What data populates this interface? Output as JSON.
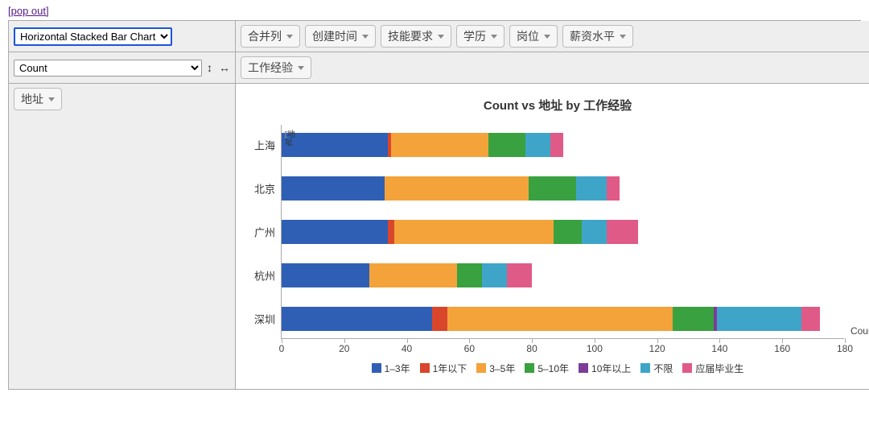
{
  "pop_out_label": "[pop out]",
  "chart_type_selector": {
    "value": "Horizontal Stacked Bar Chart"
  },
  "aggregator_selector": {
    "value": "Count"
  },
  "sort_icons": {
    "vert": "↕",
    "horiz": "↔"
  },
  "top_filters": [
    "合并列",
    "创建时间",
    "技能要求",
    "学历",
    "岗位",
    "薪资水平"
  ],
  "col_field_pill": "工作经验",
  "row_field_pill": "地址",
  "chart_data": {
    "type": "bar",
    "orientation": "horizontal",
    "stacked": true,
    "title": "Count vs 地址 by 工作经验",
    "xlabel": "Count",
    "ylabel": "",
    "xlim": [
      0,
      180
    ],
    "categories": [
      "上海",
      "北京",
      "广州",
      "深圳",
      "杭州"
    ],
    "display_order": [
      "上海",
      "北京",
      "广州",
      "杭州",
      "深圳"
    ],
    "series": [
      {
        "name": "1–3年",
        "color": "#2f5fb5",
        "values": [
          34,
          33,
          34,
          48,
          28
        ]
      },
      {
        "name": "1年以下",
        "color": "#d9462b",
        "values": [
          1,
          0,
          2,
          5,
          0
        ]
      },
      {
        "name": "3–5年",
        "color": "#f3a33a",
        "values": [
          31,
          46,
          51,
          72,
          28
        ]
      },
      {
        "name": "5–10年",
        "color": "#39a13f",
        "values": [
          12,
          15,
          9,
          13,
          8
        ]
      },
      {
        "name": "10年以上",
        "color": "#7d3c98",
        "values": [
          0,
          0,
          0,
          1,
          0
        ]
      },
      {
        "name": "不限",
        "color": "#3ea5c9",
        "values": [
          8,
          10,
          8,
          27,
          8
        ]
      },
      {
        "name": "应届毕业生",
        "color": "#e05a87",
        "values": [
          4,
          4,
          10,
          6,
          8
        ]
      }
    ],
    "xticks": [
      0,
      20,
      40,
      60,
      80,
      100,
      120,
      140,
      160,
      180
    ]
  }
}
